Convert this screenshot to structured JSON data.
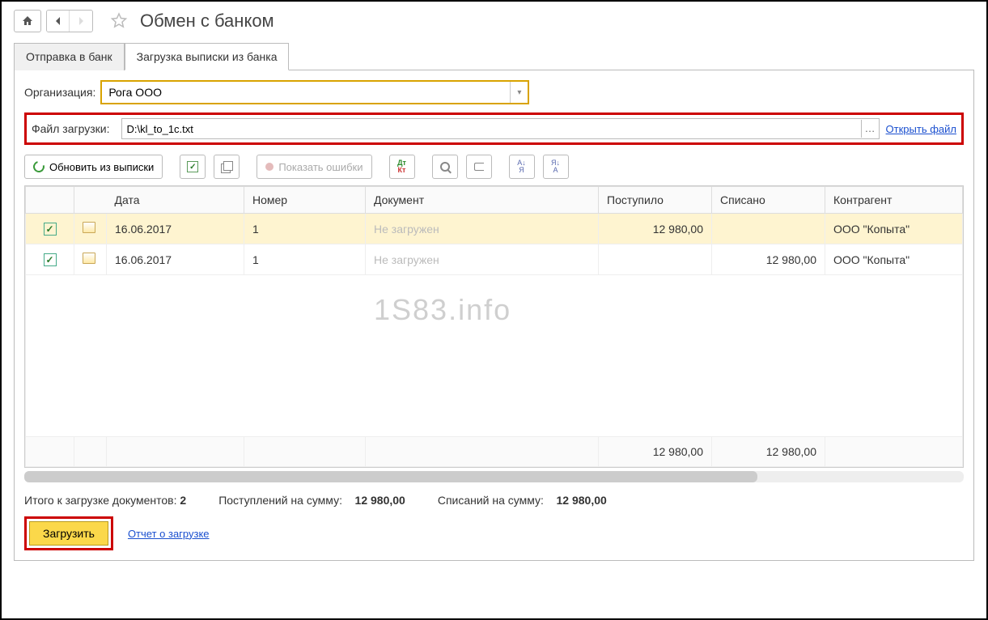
{
  "header": {
    "title": "Обмен с банком"
  },
  "tabs": {
    "send": "Отправка в банк",
    "load": "Загрузка выписки из банка"
  },
  "fields": {
    "org_label": "Организация:",
    "org_value": "Рога ООО",
    "file_label": "Файл загрузки:",
    "file_value": "D:\\kl_to_1c.txt",
    "open_file": "Открыть файл"
  },
  "toolbar": {
    "refresh": "Обновить из выписки",
    "show_errors": "Показать ошибки"
  },
  "columns": {
    "date": "Дата",
    "number": "Номер",
    "document": "Документ",
    "in": "Поступило",
    "out": "Списано",
    "party": "Контрагент"
  },
  "rows": [
    {
      "checked": true,
      "date": "16.06.2017",
      "number": "1",
      "document": "Не загружен",
      "in": "12 980,00",
      "out": "",
      "party": "ООО \"Копыта\""
    },
    {
      "checked": true,
      "date": "16.06.2017",
      "number": "1",
      "document": "Не загружен",
      "in": "",
      "out": "12 980,00",
      "party": "ООО \"Копыта\""
    }
  ],
  "totals_row": {
    "in": "12 980,00",
    "out": "12 980,00"
  },
  "summary": {
    "docs_label": "Итого к загрузке документов:",
    "docs_count": "2",
    "in_label": "Поступлений на сумму:",
    "in_sum": "12 980,00",
    "out_label": "Списаний на сумму:",
    "out_sum": "12 980,00"
  },
  "actions": {
    "load": "Загрузить",
    "report": "Отчет о загрузке"
  },
  "watermark": "1S83.info"
}
